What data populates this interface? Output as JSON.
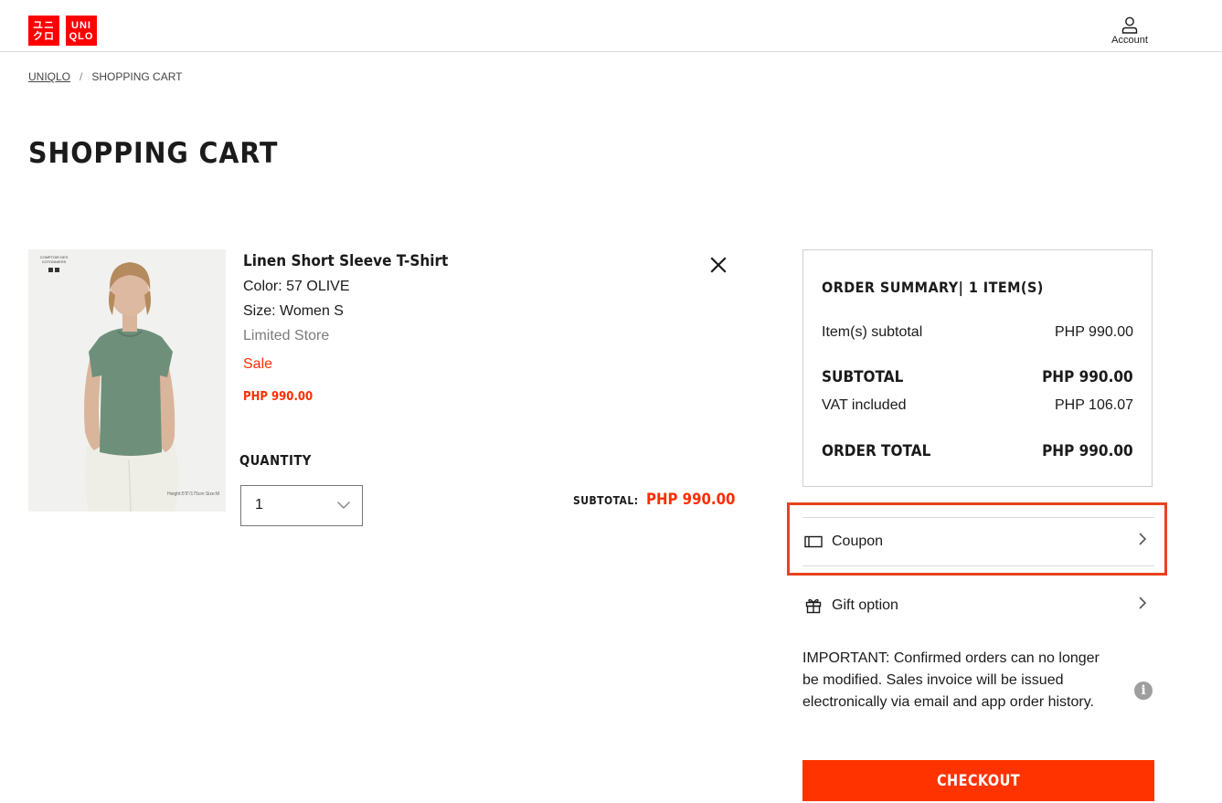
{
  "brand": {
    "logo_left": [
      "ユニ",
      "クロ"
    ],
    "logo_right": [
      "UNI",
      "QLO"
    ],
    "color": "#ff0000"
  },
  "header": {
    "account_label": "Account",
    "account_icon": "person-icon"
  },
  "breadcrumb": {
    "home": "UNIQLO",
    "separator": "/",
    "current": "SHOPPING CART"
  },
  "page": {
    "title": "SHOPPING CART"
  },
  "cart_item": {
    "name": "Linen Short Sleeve T-Shirt",
    "color": "Color: 57 OLIVE",
    "size": "Size: Women S",
    "availability": "Limited Store",
    "tag": "Sale",
    "price": "PHP 990.00",
    "image_caption_top": "COMPTOIR DES COTONNIERS",
    "image_caption_bottom": "Height:5'9\"/175cm Size:M",
    "quantity_label": "QUANTITY",
    "quantity_value": "1",
    "subtotal_label": "SUBTOTAL:",
    "subtotal_value": "PHP 990.00",
    "remove_icon": "close-icon"
  },
  "order_summary": {
    "title": "ORDER SUMMARY| 1 ITEM(S)",
    "items_subtotal_label": "Item(s) subtotal",
    "items_subtotal_value": "PHP 990.00",
    "subtotal_label": "SUBTOTAL",
    "subtotal_value": "PHP 990.00",
    "vat_label": "VAT included",
    "vat_value": "PHP 106.07",
    "total_label": "ORDER TOTAL",
    "total_value": "PHP 990.00"
  },
  "options": {
    "coupon_label": "Coupon",
    "coupon_icon": "coupon-icon",
    "gift_label": "Gift option",
    "gift_icon": "gift-icon"
  },
  "notice": {
    "text": "IMPORTANT: Confirmed orders can no longer be modified. Sales invoice will be issued electronically via email and app order history.",
    "info_icon": "info-icon"
  },
  "checkout": {
    "label": "CHECKOUT"
  },
  "colors": {
    "accent": "#ff3300",
    "sale_red": "#ff2d00",
    "highlight_border": "#e8421b"
  }
}
